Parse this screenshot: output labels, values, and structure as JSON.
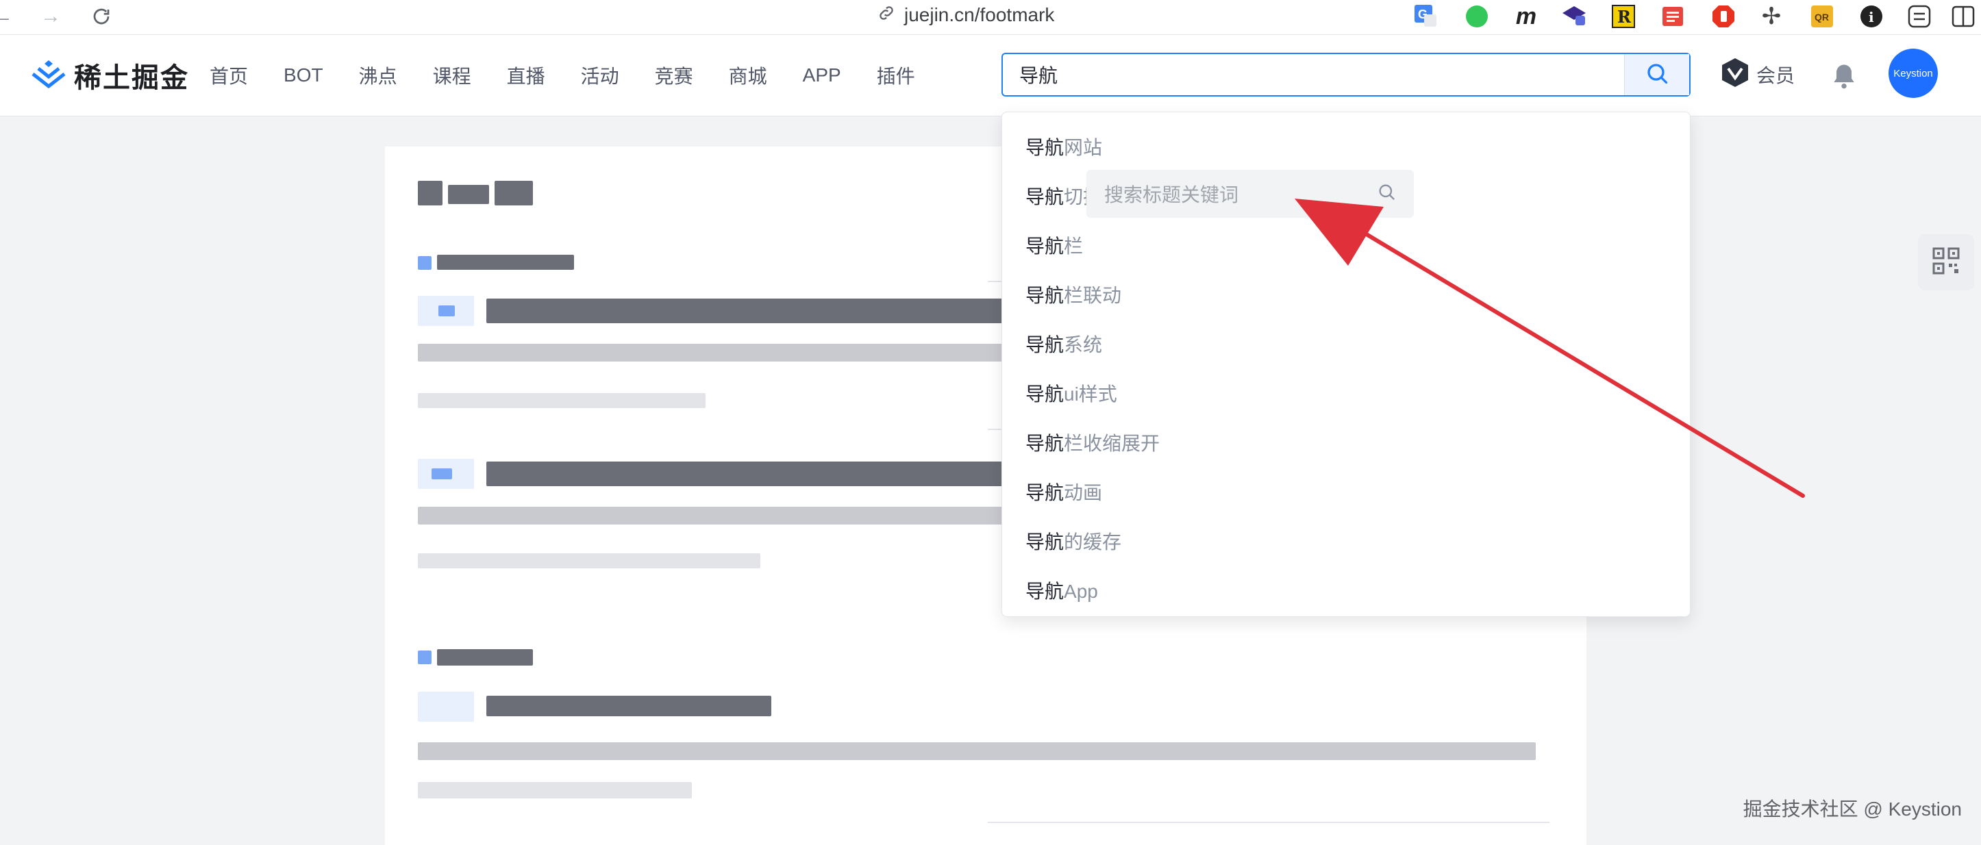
{
  "browser": {
    "url": "juejin.cn/footmark",
    "extensions": [
      "translate-icon",
      "green-dot-icon",
      "m-icon",
      "graduation-cap-icon",
      "r-icon",
      "reader-icon",
      "adblock-icon",
      "crosshair-icon",
      "qr-icon",
      "info-icon",
      "settings-toggle-icon",
      "sidebar-icon"
    ]
  },
  "header": {
    "logo_text": "稀土掘金",
    "nav": [
      "首页",
      "BOT",
      "沸点",
      "课程",
      "直播",
      "活动",
      "竞赛",
      "商城",
      "APP",
      "插件"
    ],
    "search_value": "导航",
    "vip_label": "会员",
    "avatar_text": "Keystion"
  },
  "dropdown": {
    "keyword": "导航",
    "suggestions": [
      {
        "rest": "网站"
      },
      {
        "rest": "切换"
      },
      {
        "rest": "栏"
      },
      {
        "rest": "栏联动"
      },
      {
        "rest": "系统"
      },
      {
        "rest": "ui样式"
      },
      {
        "rest": "栏收缩展开"
      },
      {
        "rest": "动画"
      },
      {
        "rest": "的缓存"
      },
      {
        "rest": "App"
      }
    ]
  },
  "inner_search": {
    "placeholder": "搜索标题关键词"
  },
  "watermark": "掘金技术社区 @ Keystion",
  "colors": {
    "accent": "#1e80ff",
    "arrow": "#e0313a",
    "page_bg": "#f2f3f5"
  }
}
